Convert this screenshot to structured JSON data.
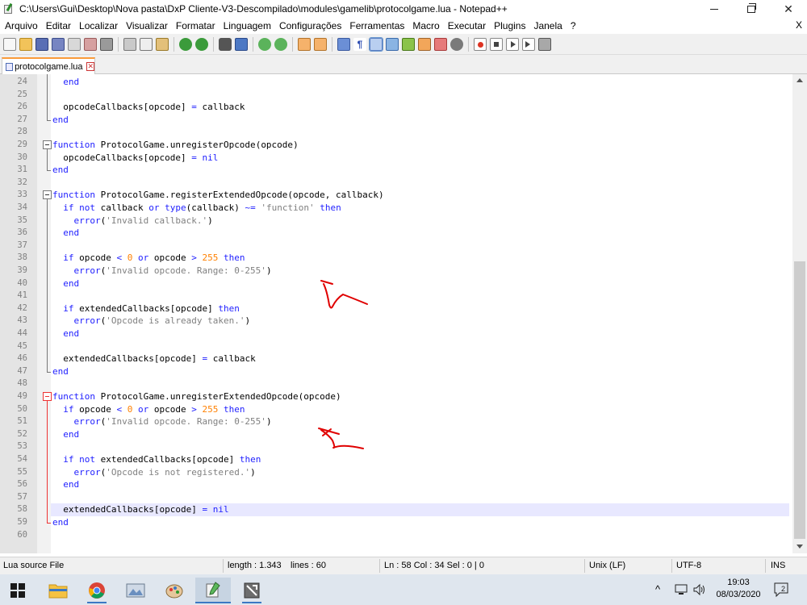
{
  "window": {
    "title": "C:\\Users\\Gui\\Desktop\\Nova pasta\\DxP Cliente-V3-Descompilado\\modules\\gamelib\\protocolgame.lua - Notepad++",
    "close_glyph": "✕"
  },
  "menu": {
    "items": [
      "Arquivo",
      "Editar",
      "Localizar",
      "Visualizar",
      "Formatar",
      "Linguagem",
      "Configurações",
      "Ferramentas",
      "Macro",
      "Executar",
      "Plugins",
      "Janela",
      "?"
    ],
    "close_label": "X"
  },
  "tab": {
    "label": "protocolgame.lua",
    "close_glyph": "✕"
  },
  "editor": {
    "lines": [
      {
        "n": "24",
        "text": "  end"
      },
      {
        "n": "25",
        "text": ""
      },
      {
        "n": "26",
        "text": "  opcodeCallbacks[opcode] = callback"
      },
      {
        "n": "27",
        "text": "end"
      },
      {
        "n": "28",
        "text": ""
      },
      {
        "n": "29",
        "text": "function ProtocolGame.unregisterOpcode(opcode)"
      },
      {
        "n": "30",
        "text": "  opcodeCallbacks[opcode] = nil"
      },
      {
        "n": "31",
        "text": "end"
      },
      {
        "n": "32",
        "text": ""
      },
      {
        "n": "33",
        "text": "function ProtocolGame.registerExtendedOpcode(opcode, callback)"
      },
      {
        "n": "34",
        "text": "  if not callback or type(callback) ~= 'function' then"
      },
      {
        "n": "35",
        "text": "    error('Invalid callback.')"
      },
      {
        "n": "36",
        "text": "  end"
      },
      {
        "n": "37",
        "text": ""
      },
      {
        "n": "38",
        "text": "  if opcode < 0 or opcode > 255 then"
      },
      {
        "n": "39",
        "text": "    error('Invalid opcode. Range: 0-255')"
      },
      {
        "n": "40",
        "text": "  end"
      },
      {
        "n": "41",
        "text": ""
      },
      {
        "n": "42",
        "text": "  if extendedCallbacks[opcode] then"
      },
      {
        "n": "43",
        "text": "    error('Opcode is already taken.')"
      },
      {
        "n": "44",
        "text": "  end"
      },
      {
        "n": "45",
        "text": ""
      },
      {
        "n": "46",
        "text": "  extendedCallbacks[opcode] = callback"
      },
      {
        "n": "47",
        "text": "end"
      },
      {
        "n": "48",
        "text": ""
      },
      {
        "n": "49",
        "text": "function ProtocolGame.unregisterExtendedOpcode(opcode)"
      },
      {
        "n": "50",
        "text": "  if opcode < 0 or opcode > 255 then"
      },
      {
        "n": "51",
        "text": "    error('Invalid opcode. Range: 0-255')"
      },
      {
        "n": "52",
        "text": "  end"
      },
      {
        "n": "53",
        "text": ""
      },
      {
        "n": "54",
        "text": "  if not extendedCallbacks[opcode] then"
      },
      {
        "n": "55",
        "text": "    error('Opcode is not registered.')"
      },
      {
        "n": "56",
        "text": "  end"
      },
      {
        "n": "57",
        "text": ""
      },
      {
        "n": "58",
        "text": "  extendedCallbacks[opcode] = nil"
      },
      {
        "n": "59",
        "text": "end"
      },
      {
        "n": "60",
        "text": ""
      }
    ],
    "current_line": "58"
  },
  "status": {
    "language": "Lua source File",
    "length": "length : 1.343",
    "lines": "lines : 60",
    "position": "Ln : 58   Col : 34   Sel : 0 | 0",
    "eol": "Unix (LF)",
    "encoding": "UTF-8",
    "mode": "INS"
  },
  "taskbar": {
    "time": "19:03",
    "date": "08/03/2020",
    "notification_count": "2",
    "tray_chevron": "^"
  },
  "colors": {
    "keyword": "#1f1fff",
    "string": "#808080",
    "number": "#ff8000",
    "annotation": "#e00000",
    "current_line": "#e8e8ff"
  }
}
